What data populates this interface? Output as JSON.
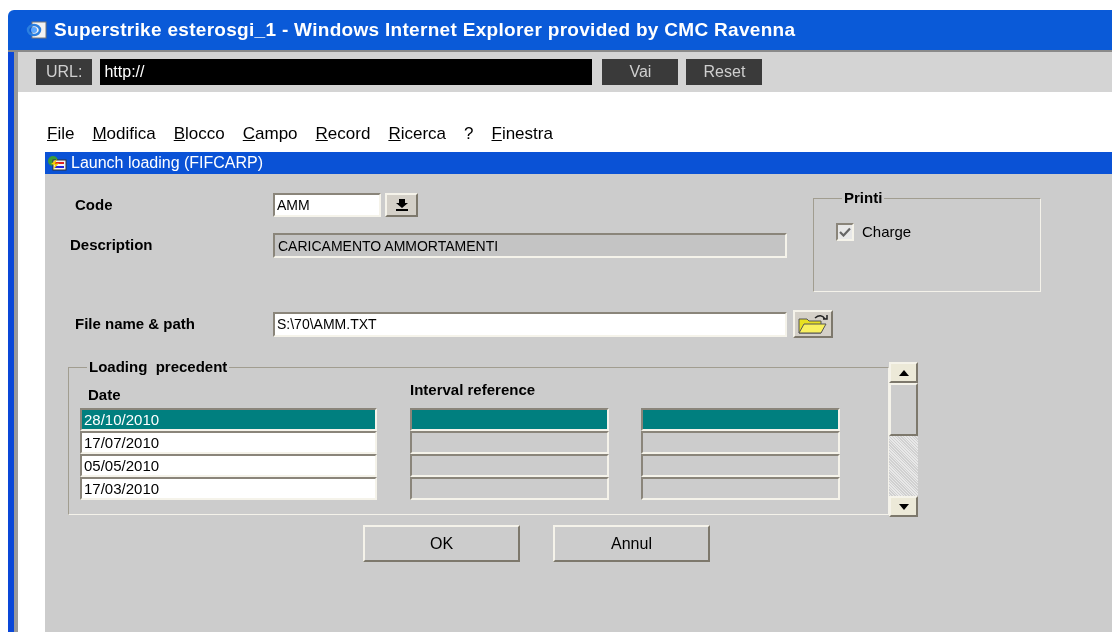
{
  "window": {
    "title": "Superstrike esterosgi_1 - Windows Internet Explorer provided by CMC Ravenna"
  },
  "url_bar": {
    "label": "URL:",
    "value": "http://",
    "buttons": [
      "Vai",
      "Reset"
    ]
  },
  "menu": [
    {
      "label": "File",
      "mnemonic": true
    },
    {
      "label": "Modifica",
      "mnemonic": true
    },
    {
      "label": "Blocco",
      "mnemonic": true
    },
    {
      "label": "Campo",
      "mnemonic": true
    },
    {
      "label": "Record",
      "mnemonic": true
    },
    {
      "label": "Ricerca",
      "mnemonic": true
    },
    {
      "label": "?",
      "mnemonic": false
    },
    {
      "label": "Finestra",
      "mnemonic": true
    }
  ],
  "form": {
    "title": "Launch loading (FIFCARP)",
    "code": {
      "label": "Code",
      "value": "AMM"
    },
    "description": {
      "label": "Description",
      "value": "CARICAMENTO AMMORTAMENTI"
    },
    "printi": {
      "title": "Printi",
      "options": [
        {
          "label": "Charge",
          "checked": true
        }
      ]
    },
    "file": {
      "label": "File name & path",
      "value": "S:\\70\\AMM.TXT"
    },
    "loading": {
      "title": "Loading  precedent",
      "columns": [
        "Date",
        "Interval reference"
      ],
      "rows": [
        {
          "date": "28/10/2010",
          "selected": true
        },
        {
          "date": "17/07/2010",
          "selected": false
        },
        {
          "date": "05/05/2010",
          "selected": false
        },
        {
          "date": "17/03/2010",
          "selected": false
        }
      ]
    },
    "buttons": [
      "OK",
      "Annul"
    ]
  }
}
